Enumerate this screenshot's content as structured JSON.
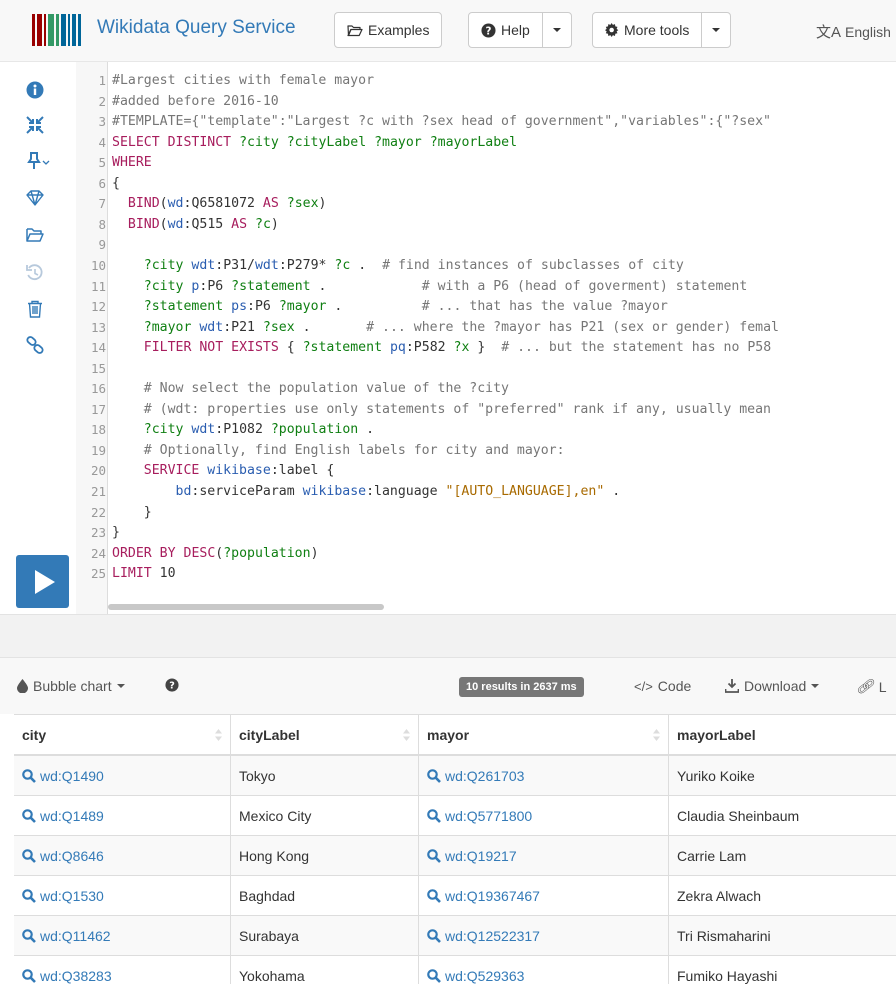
{
  "navbar": {
    "brand": "Wikidata Query Service",
    "examples_label": "Examples",
    "help_label": "Help",
    "more_tools_label": "More tools",
    "language_label": "English",
    "colors": {
      "brand": "#337ab7",
      "logo_red": "#990000",
      "logo_green": "#339966",
      "logo_blue": "#006699"
    }
  },
  "sidebar": {
    "tools": [
      "info-icon",
      "shrink-icon",
      "pin-icon",
      "diamond-icon",
      "folder-icon",
      "history-icon",
      "trash-icon",
      "link-icon"
    ],
    "run_label": "Run"
  },
  "editor": {
    "lines": [
      "#Largest cities with female mayor",
      "#added before 2016-10",
      "#TEMPLATE={\"template\":\"Largest ?c with ?sex head of government\",\"variables\":{\"?sex\"",
      "SELECT DISTINCT ?city ?cityLabel ?mayor ?mayorLabel",
      "WHERE",
      "{",
      "  BIND(wd:Q6581072 AS ?sex)",
      "  BIND(wd:Q515 AS ?c)",
      "",
      "    ?city wdt:P31/wdt:P279* ?c .  # find instances of subclasses of city",
      "    ?city p:P6 ?statement .            # with a P6 (head of goverment) statement",
      "    ?statement ps:P6 ?mayor .          # ... that has the value ?mayor",
      "    ?mayor wdt:P21 ?sex .       # ... where the ?mayor has P21 (sex or gender) femal",
      "    FILTER NOT EXISTS { ?statement pq:P582 ?x }  # ... but the statement has no P58",
      "",
      "    # Now select the population value of the ?city",
      "    # (wdt: properties use only statements of \"preferred\" rank if any, usually mean",
      "    ?city wdt:P1082 ?population .",
      "    # Optionally, find English labels for city and mayor:",
      "    SERVICE wikibase:label {",
      "        bd:serviceParam wikibase:language \"[AUTO_LANGUAGE],en\" .",
      "    }",
      "}",
      "ORDER BY DESC(?population)",
      "LIMIT 10"
    ]
  },
  "results": {
    "view_label": "Bubble chart",
    "count_badge": "10 results in 2637 ms",
    "code_label": "Code",
    "download_label": "Download",
    "link_label": "L",
    "columns": [
      "city",
      "cityLabel",
      "mayor",
      "mayorLabel"
    ],
    "rows": [
      [
        "wd:Q1490",
        "Tokyo",
        "wd:Q261703",
        "Yuriko Koike"
      ],
      [
        "wd:Q1489",
        "Mexico City",
        "wd:Q5771800",
        "Claudia Sheinbaum"
      ],
      [
        "wd:Q8646",
        "Hong Kong",
        "wd:Q19217",
        "Carrie Lam"
      ],
      [
        "wd:Q1530",
        "Baghdad",
        "wd:Q19367467",
        "Zekra Alwach"
      ],
      [
        "wd:Q11462",
        "Surabaya",
        "wd:Q12522317",
        "Tri Rismaharini"
      ],
      [
        "wd:Q38283",
        "Yokohama",
        "wd:Q529363",
        "Fumiko Hayashi"
      ]
    ]
  }
}
